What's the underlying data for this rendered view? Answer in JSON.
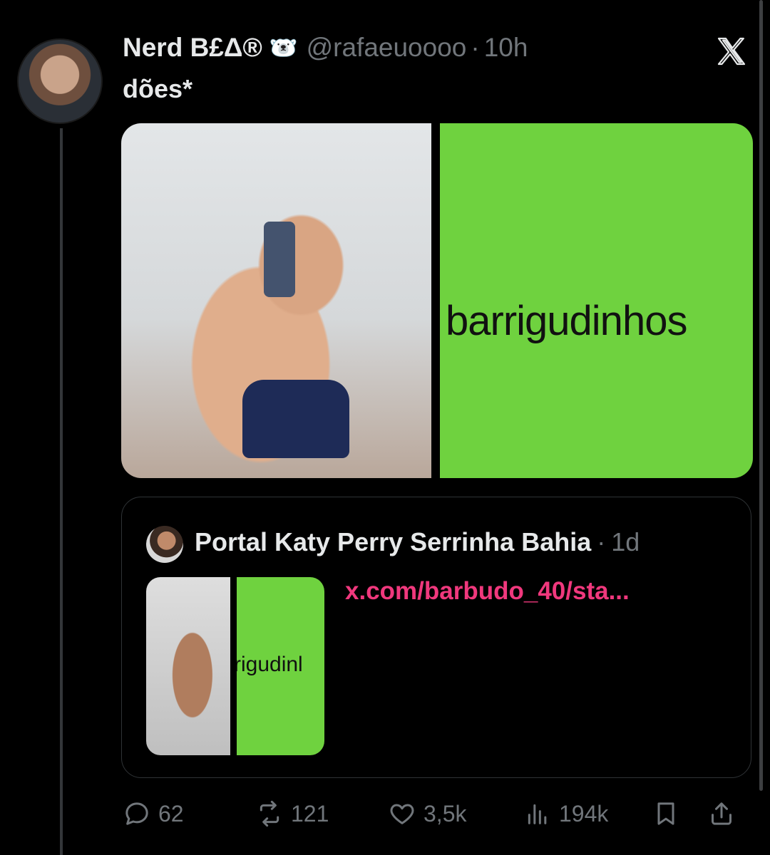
{
  "tweet": {
    "author_name": "Nerd B£Δ®",
    "author_emoji": "🐻‍❄️",
    "handle": "@rafaeuoooo",
    "separator": "·",
    "time": "10h",
    "text": "dões*",
    "media_word": "barrigudinhos"
  },
  "quote": {
    "author_name": "Portal Katy Perry Serrinha Bahia",
    "separator": "·",
    "time": "1d",
    "link": "x.com/barbudo_40/sta...",
    "thumb_word": "rrigudinl"
  },
  "actions": {
    "replies": "62",
    "reposts": "121",
    "likes": "3,5k",
    "views": "194k"
  },
  "icons": {
    "reply": "reply-icon",
    "repost": "repost-icon",
    "like": "heart-icon",
    "views": "views-icon",
    "bookmark": "bookmark-icon",
    "share": "share-icon",
    "logo": "x-logo-icon"
  },
  "colors": {
    "background": "#000000",
    "text": "#e7e9ea",
    "muted": "#71767b",
    "link": "#f0387d",
    "media_green": "#6fd23f"
  }
}
